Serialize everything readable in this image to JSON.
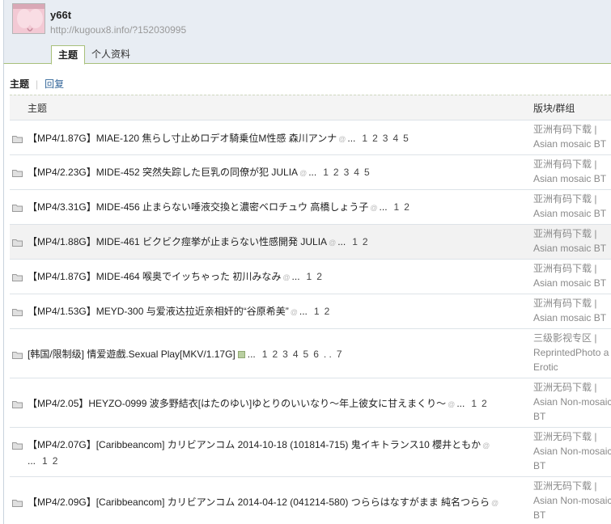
{
  "user": {
    "name": "y66t",
    "url": "http://kugoux8.info/?152030995"
  },
  "tabs": [
    {
      "label": "主题",
      "active": true
    },
    {
      "label": "个人资料",
      "active": false
    }
  ],
  "subnav": {
    "current": "主题",
    "other": "回复"
  },
  "columns": {
    "topic": "主题",
    "forum": "版块/群组"
  },
  "rows": [
    {
      "title": "【MP4/1.87G】MIAE-120 焦らし寸止めロデオ騎乗位M性感 森川アンナ",
      "ellipsis": "...",
      "pages": [
        "1",
        "2",
        "3",
        "4",
        "5"
      ],
      "forum1": "亚洲有码下载 |",
      "forum2": "Asian mosaic BT"
    },
    {
      "title": "【MP4/2.23G】MIDE-452 突然失踪した巨乳の同僚が犯 JULIA",
      "ellipsis": "...",
      "pages": [
        "1",
        "2",
        "3",
        "4",
        "5"
      ],
      "forum1": "亚洲有码下载 |",
      "forum2": "Asian mosaic BT"
    },
    {
      "title": "【MP4/3.31G】MIDE-456 止まらない唾液交換と濃密ベロチュウ 高橋しょう子",
      "ellipsis": "...",
      "pages": [
        "1",
        "2"
      ],
      "forum1": "亚洲有码下载 |",
      "forum2": "Asian mosaic BT"
    },
    {
      "title": "【MP4/1.88G】MIDE-461 ビクビク痙挙が止まらない性感開発 JULIA",
      "ellipsis": "...",
      "pages": [
        "1",
        "2"
      ],
      "forum1": "亚洲有码下载 |",
      "forum2": "Asian mosaic BT"
    },
    {
      "title": "【MP4/1.87G】MIDE-464 喉奥でイッちゃった 初川みなみ",
      "ellipsis": "...",
      "pages": [
        "1",
        "2"
      ],
      "forum1": "亚洲有码下载 |",
      "forum2": "Asian mosaic BT"
    },
    {
      "title": "【MP4/1.53G】MEYD-300 与爱液达拉近亲相奸的“谷原希美”",
      "ellipsis": "...",
      "pages": [
        "1",
        "2"
      ],
      "forum1": "亚洲有码下载 |",
      "forum2": "Asian mosaic BT"
    },
    {
      "title": "[韩国/限制级] 情爱遊戲.Sexual Play[MKV/1.17G]",
      "ellipsis": "...",
      "pages": [
        "1",
        "2",
        "3",
        "4",
        "5",
        "6",
        ". .",
        "7"
      ],
      "forum1": "三级影视专区 |",
      "forum2": "ReprintedPhoto a",
      "forum3": "Erotic"
    },
    {
      "title": "【MP4/2.05】HEYZO-0999 波多野結衣[はたのゆい]ゆとりのいいなり～年上彼女に甘えまくり～",
      "ellipsis": "...",
      "pages": [
        "1",
        "2"
      ],
      "forum1": "亚洲无码下载 |",
      "forum2": "Asian Non-mosaic",
      "forum3": "BT"
    },
    {
      "title": "【MP4/2.07G】[Caribbeancom] カリビアンコム 2014-10-18 (101814-715) 鬼イキトランス10 櫻井ともか",
      "ellipsis": "...",
      "pages": [
        "1",
        "2"
      ],
      "forum1": "亚洲无码下载 |",
      "forum2": "Asian Non-mosaic",
      "forum3": "BT"
    },
    {
      "title": "【MP4/2.09G】[Caribbeancom] カリビアンコム 2014-04-12 (041214-580) つららはなすがまま 純名つらら",
      "ellipsis": "",
      "pages": [],
      "forum1": "亚洲无码下载 |",
      "forum2": "Asian Non-mosaic",
      "forum3": "BT"
    }
  ]
}
